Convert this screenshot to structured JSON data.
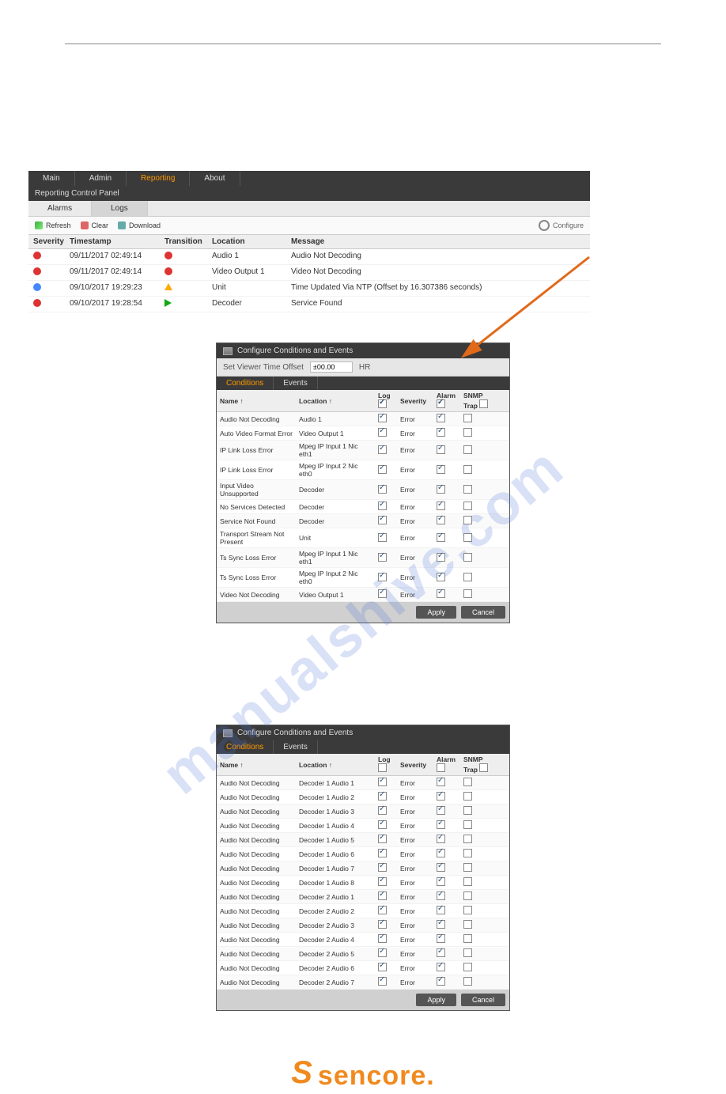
{
  "watermark": "manualshive.com",
  "tabs": {
    "items": [
      {
        "label": "Main"
      },
      {
        "label": "Admin"
      },
      {
        "label": "Reporting",
        "active": true
      },
      {
        "label": "About"
      }
    ]
  },
  "panel_title": "Reporting Control Panel",
  "subtabs": [
    {
      "label": "Alarms"
    },
    {
      "label": "Logs",
      "selected": true
    }
  ],
  "toolbar": {
    "refresh": "Refresh",
    "clear": "Clear",
    "download": "Download",
    "configure": "Configure"
  },
  "log_columns": [
    "Severity",
    "Timestamp",
    "Transition",
    "Location",
    "Message"
  ],
  "log_rows": [
    {
      "sev": "error",
      "ts": "09/11/2017 02:49:14",
      "trans": "error",
      "loc": "Audio 1",
      "msg": "Audio Not Decoding"
    },
    {
      "sev": "error",
      "ts": "09/11/2017 02:49:14",
      "trans": "error",
      "loc": "Video Output 1",
      "msg": "Video Not Decoding"
    },
    {
      "sev": "info",
      "ts": "09/10/2017 19:29:23",
      "trans": "event",
      "loc": "Unit",
      "msg": "Time Updated Via NTP (Offset by 16.307386 seconds)"
    },
    {
      "sev": "error",
      "ts": "09/10/2017 19:28:54",
      "trans": "clear",
      "loc": "Decoder",
      "msg": "Service Found"
    }
  ],
  "dialog1": {
    "title": "Configure Conditions and Events",
    "offset_label": "Set Viewer Time Offset",
    "offset_value": "±00.00",
    "offset_unit": "HR",
    "tabs": [
      {
        "label": "Conditions",
        "active": true
      },
      {
        "label": "Events"
      }
    ],
    "columns": [
      "Name ↑",
      "Location ↑",
      "Log",
      "Severity",
      "Alarm",
      "SNMP Trap"
    ],
    "head_checks": {
      "log": true,
      "alarm": true,
      "trap": false
    },
    "rows": [
      {
        "name": "Audio Not Decoding",
        "loc": "Audio 1",
        "log": true,
        "sev": "Error",
        "alarm": true,
        "trap": false
      },
      {
        "name": "Auto Video Format Error",
        "loc": "Video Output 1",
        "log": true,
        "sev": "Error",
        "alarm": true,
        "trap": false
      },
      {
        "name": "IP Link Loss Error",
        "loc": "Mpeg IP Input 1 Nic eth1",
        "log": true,
        "sev": "Error",
        "alarm": true,
        "trap": false
      },
      {
        "name": "IP Link Loss Error",
        "loc": "Mpeg IP Input 2 Nic eth0",
        "log": true,
        "sev": "Error",
        "alarm": true,
        "trap": false
      },
      {
        "name": "Input Video Unsupported",
        "loc": "Decoder",
        "log": true,
        "sev": "Error",
        "alarm": true,
        "trap": false
      },
      {
        "name": "No Services Detected",
        "loc": "Decoder",
        "log": true,
        "sev": "Error",
        "alarm": true,
        "trap": false
      },
      {
        "name": "Service Not Found",
        "loc": "Decoder",
        "log": true,
        "sev": "Error",
        "alarm": true,
        "trap": false
      },
      {
        "name": "Transport Stream Not Present",
        "loc": "Unit",
        "log": true,
        "sev": "Error",
        "alarm": true,
        "trap": false
      },
      {
        "name": "Ts Sync Loss Error",
        "loc": "Mpeg IP Input 1 Nic eth1",
        "log": true,
        "sev": "Error",
        "alarm": true,
        "trap": false
      },
      {
        "name": "Ts Sync Loss Error",
        "loc": "Mpeg IP Input 2 Nic eth0",
        "log": true,
        "sev": "Error",
        "alarm": true,
        "trap": false
      },
      {
        "name": "Video Not Decoding",
        "loc": "Video Output 1",
        "log": true,
        "sev": "Error",
        "alarm": true,
        "trap": false
      }
    ],
    "buttons": {
      "apply": "Apply",
      "cancel": "Cancel"
    }
  },
  "dialog2": {
    "title": "Configure Conditions and Events",
    "tabs": [
      {
        "label": "Conditions",
        "active": true
      },
      {
        "label": "Events"
      }
    ],
    "columns": [
      "Name ↑",
      "Location ↑",
      "Log",
      "Severity",
      "Alarm",
      "SNMP Trap"
    ],
    "head_checks": {
      "log": false,
      "alarm": false,
      "trap": false
    },
    "rows": [
      {
        "name": "Audio Not Decoding",
        "loc": "Decoder 1 Audio 1",
        "log": true,
        "sev": "Error",
        "alarm": true,
        "trap": false
      },
      {
        "name": "Audio Not Decoding",
        "loc": "Decoder 1 Audio 2",
        "log": true,
        "sev": "Error",
        "alarm": true,
        "trap": false
      },
      {
        "name": "Audio Not Decoding",
        "loc": "Decoder 1 Audio 3",
        "log": true,
        "sev": "Error",
        "alarm": true,
        "trap": false
      },
      {
        "name": "Audio Not Decoding",
        "loc": "Decoder 1 Audio 4",
        "log": true,
        "sev": "Error",
        "alarm": true,
        "trap": false
      },
      {
        "name": "Audio Not Decoding",
        "loc": "Decoder 1 Audio 5",
        "log": true,
        "sev": "Error",
        "alarm": true,
        "trap": false
      },
      {
        "name": "Audio Not Decoding",
        "loc": "Decoder 1 Audio 6",
        "log": true,
        "sev": "Error",
        "alarm": true,
        "trap": false
      },
      {
        "name": "Audio Not Decoding",
        "loc": "Decoder 1 Audio 7",
        "log": true,
        "sev": "Error",
        "alarm": true,
        "trap": false
      },
      {
        "name": "Audio Not Decoding",
        "loc": "Decoder 1 Audio 8",
        "log": true,
        "sev": "Error",
        "alarm": true,
        "trap": false
      },
      {
        "name": "Audio Not Decoding",
        "loc": "Decoder 2 Audio 1",
        "log": true,
        "sev": "Error",
        "alarm": true,
        "trap": false
      },
      {
        "name": "Audio Not Decoding",
        "loc": "Decoder 2 Audio 2",
        "log": true,
        "sev": "Error",
        "alarm": true,
        "trap": false
      },
      {
        "name": "Audio Not Decoding",
        "loc": "Decoder 2 Audio 3",
        "log": true,
        "sev": "Error",
        "alarm": true,
        "trap": false
      },
      {
        "name": "Audio Not Decoding",
        "loc": "Decoder 2 Audio 4",
        "log": true,
        "sev": "Error",
        "alarm": true,
        "trap": false
      },
      {
        "name": "Audio Not Decoding",
        "loc": "Decoder 2 Audio 5",
        "log": true,
        "sev": "Error",
        "alarm": true,
        "trap": false
      },
      {
        "name": "Audio Not Decoding",
        "loc": "Decoder 2 Audio 6",
        "log": true,
        "sev": "Error",
        "alarm": true,
        "trap": false
      },
      {
        "name": "Audio Not Decoding",
        "loc": "Decoder 2 Audio 7",
        "log": true,
        "sev": "Error",
        "alarm": true,
        "trap": false
      }
    ],
    "buttons": {
      "apply": "Apply",
      "cancel": "Cancel"
    }
  },
  "logo": "sencore."
}
